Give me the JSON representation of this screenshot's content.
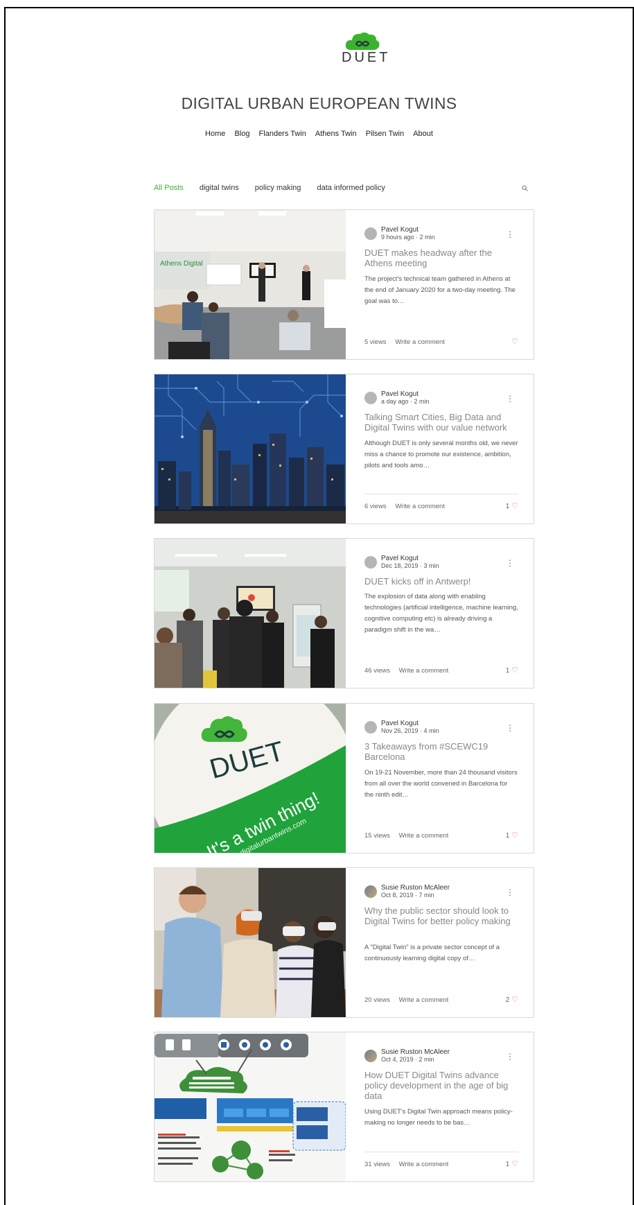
{
  "site": {
    "logo_text": "DUET",
    "title": "DIGITAL URBAN EUROPEAN TWINS",
    "nav": [
      "Home",
      "Blog",
      "Flanders Twin",
      "Athens Twin",
      "Pilsen Twin",
      "About"
    ]
  },
  "categories": [
    "All Posts",
    "digital twins",
    "policy making",
    "data informed policy"
  ],
  "colors": {
    "accent": "#3cb22f",
    "heart": "#e0584e"
  },
  "posts": [
    {
      "author": "Pavel Kogut",
      "meta": "9 hours ago · 2 min",
      "title": "DUET makes headway after the Athens meeting",
      "excerpt": "The project's technical team gathered in Athens at the end of January 2020 for a two-day meeting. The goal was to…",
      "views": "5 views",
      "comment": "Write a comment",
      "likes": ""
    },
    {
      "author": "Pavel Kogut",
      "meta": "a day ago · 2 min",
      "title": "Talking Smart Cities, Big Data and Digital Twins with our value network",
      "excerpt": "Although DUET is only several months old, we never miss a chance to promote our existence, ambition, pilots and tools amo…",
      "views": "6 views",
      "comment": "Write a comment",
      "likes": "1"
    },
    {
      "author": "Pavel Kogut",
      "meta": "Dec 18, 2019 · 3 min",
      "title": "DUET kicks off in Antwerp!",
      "excerpt": "The explosion of data along with enabling technologies (artificial intelligence, machine learning, cognitive computing etc) is already driving a paradigm shift in the wa…",
      "views": "46 views",
      "comment": "Write a comment",
      "likes": "1"
    },
    {
      "author": "Pavel Kogut",
      "meta": "Nov 26, 2019 · 4 min",
      "title": "3 Takeaways from #SCEWC19 Barcelona",
      "excerpt": "On 19-21 November, more than 24 thousand visitors from all over the world convened in Barcelona for the ninth edit…",
      "views": "15 views",
      "comment": "Write a comment",
      "likes": "1"
    },
    {
      "author": "Susie Ruston McAleer",
      "meta": "Oct 8, 2019 · 7 min",
      "title": "Why the public sector should look to Digital Twins for better policy making",
      "excerpt": "A \"Digital Twin\" is a private sector concept of a continuously learning digital copy of…",
      "views": "20 views",
      "comment": "Write a comment",
      "likes": "2"
    },
    {
      "author": "Susie Ruston McAleer",
      "meta": "Oct 4, 2019 · 2 min",
      "title": "How DUET Digital Twins advance policy development in the age of big data",
      "excerpt": "Using DUET's Digital Twin approach means policy-making no longer needs to be bas…",
      "views": "31 views",
      "comment": "Write a comment",
      "likes": "1"
    }
  ],
  "image_text": {
    "sticker_brand": "DUET",
    "sticker_slogan": "It's a twin thing!",
    "sticker_url": "digitalurbantwins.com",
    "athens_sign": "Athens Digital"
  }
}
